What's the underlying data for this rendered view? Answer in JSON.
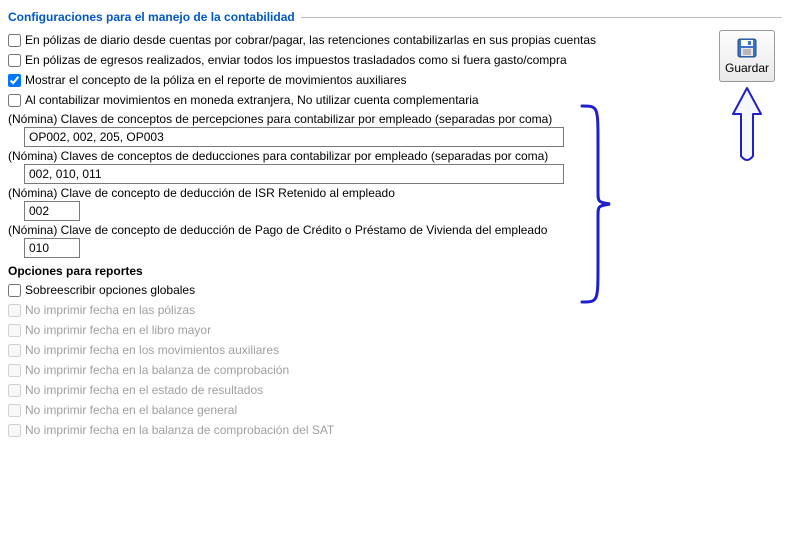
{
  "section_title": "Configuraciones para el manejo de la contabilidad",
  "checkboxes": {
    "diario_retenciones": "En pólizas de diario desde cuentas por cobrar/pagar, las retenciones contabilizarlas en sus propias cuentas",
    "egresos_traslados": "En pólizas de egresos realizados, enviar todos los impuestos trasladados como si fuera gasto/compra",
    "mostrar_concepto": "Mostrar el concepto de la póliza en el reporte de movimientos auxiliares",
    "moneda_extranjera": "Al contabilizar movimientos en moneda extranjera, No utilizar cuenta complementaria"
  },
  "nomina": {
    "percepciones_label": "(Nómina) Claves de conceptos de percepciones para contabilizar por empleado (separadas por coma)",
    "percepciones_value": "OP002, 002, 205, OP003",
    "deducciones_label": "(Nómina) Claves de conceptos de deducciones para contabilizar por empleado (separadas por coma)",
    "deducciones_value": "002, 010, 011",
    "isr_label": "(Nómina) Clave de concepto de deducción de ISR Retenido al empleado",
    "isr_value": "002",
    "vivienda_label": "(Nómina) Clave de concepto de deducción de Pago de Crédito o Préstamo de Vivienda del empleado",
    "vivienda_value": "010"
  },
  "save_label": "Guardar",
  "reports": {
    "header": "Opciones para reportes",
    "override": "Sobreescribir opciones globales",
    "no_fecha_polizas": "No imprimir fecha en las pólizas",
    "no_fecha_mayor": "No imprimir fecha en el libro mayor",
    "no_fecha_aux": "No imprimir fecha en los movimientos auxiliares",
    "no_fecha_balanza": "No imprimir fecha en la balanza de comprobación",
    "no_fecha_resultados": "No imprimir fecha en el estado de resultados",
    "no_fecha_balance": "No imprimir fecha en el balance general",
    "no_fecha_balanza_sat": "No imprimir fecha en la balanza de comprobación del SAT"
  }
}
